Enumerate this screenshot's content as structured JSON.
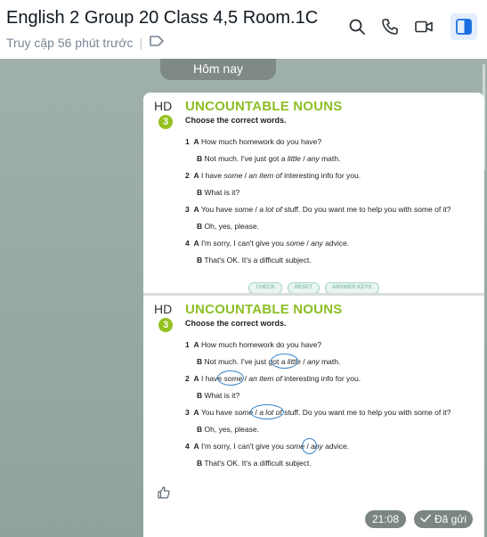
{
  "header": {
    "title": "English 2 Group 20 Class 4,5 Room.1C",
    "last_seen": "Truy cập 56 phút trước",
    "separator": "|"
  },
  "chat": {
    "date_label": "Hôm nay",
    "message": {
      "time": "21:08",
      "status": "Đã gửi"
    }
  },
  "worksheet": {
    "logo": "HD",
    "exercise_number": "3",
    "title": "UNCOUNTABLE NOUNS",
    "instruction": "Choose the correct words.",
    "items": [
      {
        "n": "1",
        "a_pre": "How much homework do you have?",
        "b": "Not much. I've just got a ",
        "b_opt1": "little",
        "b_slash": " / ",
        "b_opt2": "any",
        "b_post": " math."
      },
      {
        "n": "2",
        "a_pre": "I have ",
        "a_opt1": "some",
        "a_slash": " / ",
        "a_opt2": "an item of",
        "a_post": " interesting info for you.",
        "b": "What is it?"
      },
      {
        "n": "3",
        "a_pre": "You have ",
        "a_opt1": "some",
        "a_slash": " / ",
        "a_opt2": "a lot of",
        "a_post": " stuff. Do you want me to help you with some of it?",
        "b": "Oh, yes, please."
      },
      {
        "n": "4",
        "a_pre": "I'm sorry, I can't give you ",
        "a_opt1": "some",
        "a_slash": " / ",
        "a_opt2": "any",
        "a_post": " advice.",
        "b": "That's OK. It's a difficult subject."
      }
    ],
    "label_a": "A",
    "label_b": "B",
    "buttons": [
      "CHECK",
      "RESET",
      "ANSWER KEYS"
    ]
  }
}
